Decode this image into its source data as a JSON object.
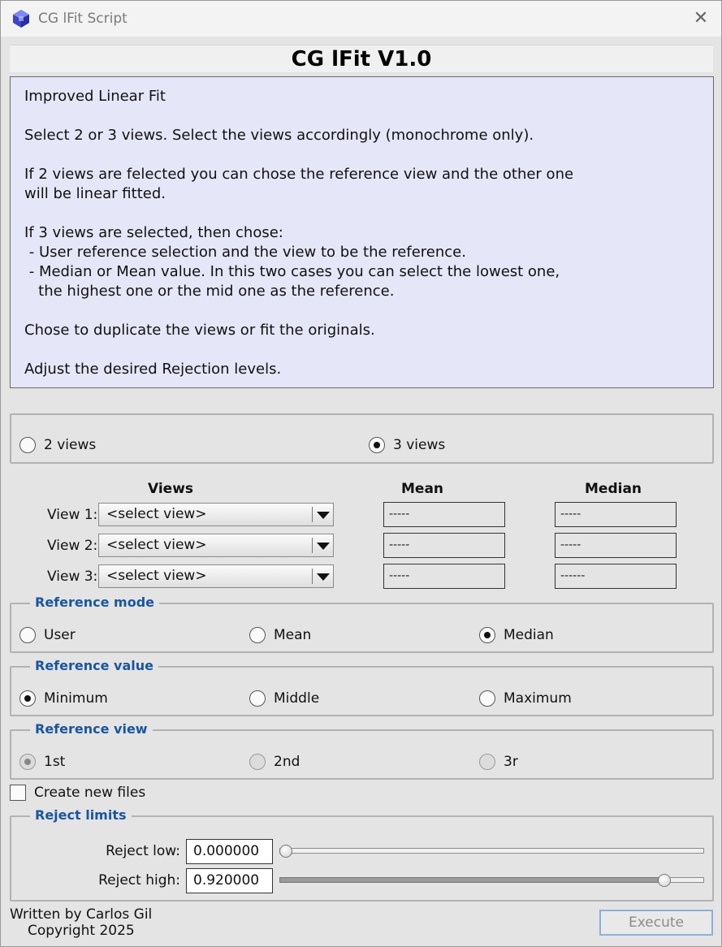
{
  "window": {
    "title": "CG lFit Script",
    "close_glyph": "✕",
    "app_icon": "pixinsight-cube-icon"
  },
  "header": {
    "title": "CG lFit V1.0"
  },
  "info": {
    "lines": [
      "Improved Linear Fit",
      "",
      "Select 2 or 3 views. Select the views accordingly (monochrome only).",
      "",
      "If 2 views are felected you can chose the reference view and the other one",
      "will be linear fitted.",
      "",
      "If 3 views are selected, then chose:",
      " - User reference selection and the view to be the reference.",
      " - Median or Mean value. In this two cases you can select the lowest one,",
      "   the highest one or the mid one as the reference.",
      "",
      "Chose to duplicate the views or fit the originals.",
      "",
      "Adjust the desired Rejection levels."
    ]
  },
  "view_count": {
    "options": [
      {
        "label": "2 views",
        "selected": false
      },
      {
        "label": "3 views",
        "selected": true
      }
    ]
  },
  "views_table": {
    "headers": {
      "views": "Views",
      "mean": "Mean",
      "median": "Median"
    },
    "rows": [
      {
        "label": "View 1:",
        "select": "<select view>",
        "mean": "-----",
        "median": "-----"
      },
      {
        "label": "View 2:",
        "select": "<select view>",
        "mean": "-----",
        "median": "-----"
      },
      {
        "label": "View 3:",
        "select": "<select view>",
        "mean": "-----",
        "median": "------"
      }
    ]
  },
  "reference_mode": {
    "title": "Reference mode",
    "options": [
      {
        "label": "User",
        "selected": false
      },
      {
        "label": "Mean",
        "selected": false
      },
      {
        "label": "Median",
        "selected": true
      }
    ]
  },
  "reference_value": {
    "title": "Reference value",
    "options": [
      {
        "label": "Minimum",
        "selected": true
      },
      {
        "label": "Middle",
        "selected": false
      },
      {
        "label": "Maximum",
        "selected": false
      }
    ]
  },
  "reference_view": {
    "title": "Reference view",
    "disabled": true,
    "options": [
      {
        "label": "1st",
        "selected": true
      },
      {
        "label": "2nd",
        "selected": false
      },
      {
        "label": "3r",
        "selected": false
      }
    ]
  },
  "create_new_files": {
    "label": "Create new files",
    "checked": false
  },
  "reject_limits": {
    "title": "Reject limits",
    "low": {
      "label": "Reject low:",
      "value": "0.000000",
      "fraction": 0.0
    },
    "high": {
      "label": "Reject high:",
      "value": "0.920000",
      "fraction": 0.92
    }
  },
  "footer": {
    "author": "Written by Carlos Gil",
    "copyright": "Copyright 2025",
    "execute_label": "Execute"
  }
}
